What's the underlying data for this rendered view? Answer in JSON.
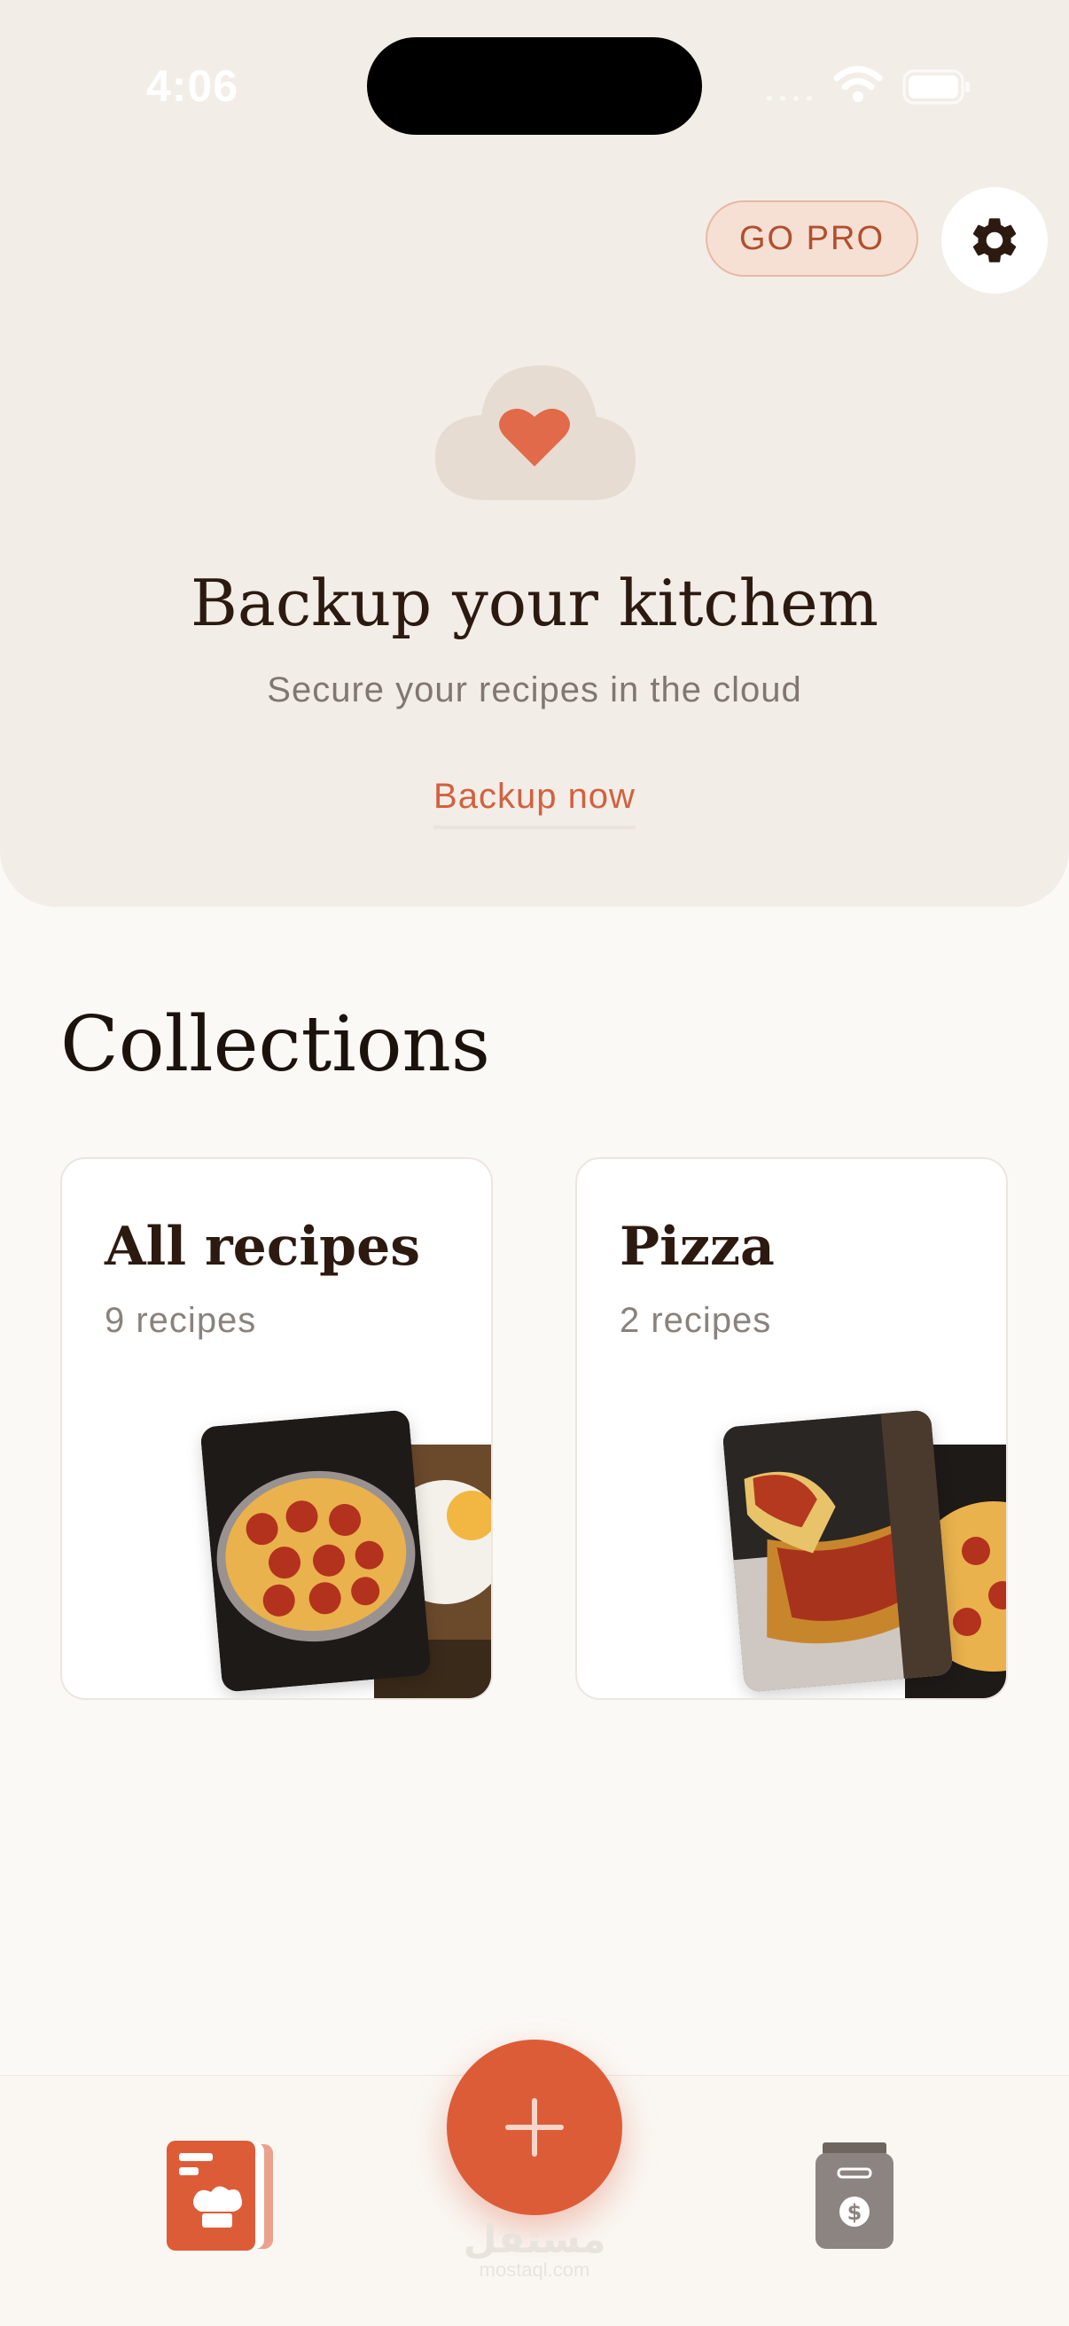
{
  "status_bar": {
    "time": "4:06"
  },
  "header": {
    "go_pro_label": "GO PRO"
  },
  "hero": {
    "title": "Backup your kitchem",
    "subtitle": "Secure your recipes in the cloud",
    "backup_label": "Backup now"
  },
  "collections": {
    "title": "Collections",
    "items": [
      {
        "name": "All recipes",
        "count": "9 recipes"
      },
      {
        "name": "Pizza",
        "count": "2 recipes"
      }
    ]
  },
  "watermark": {
    "arabic": "مستقل",
    "latin": "mostaql.com"
  },
  "colors": {
    "accent": "#dd5c38",
    "hero_bg": "#f3ede7",
    "page_bg": "#fbf9f6",
    "title_text": "#2c1a10"
  },
  "icons": [
    "gear-icon",
    "cloud-heart-icon",
    "plus-icon",
    "recipe-book-icon",
    "shopping-bag-icon",
    "wifi-icon",
    "battery-icon",
    "signal-icon"
  ]
}
